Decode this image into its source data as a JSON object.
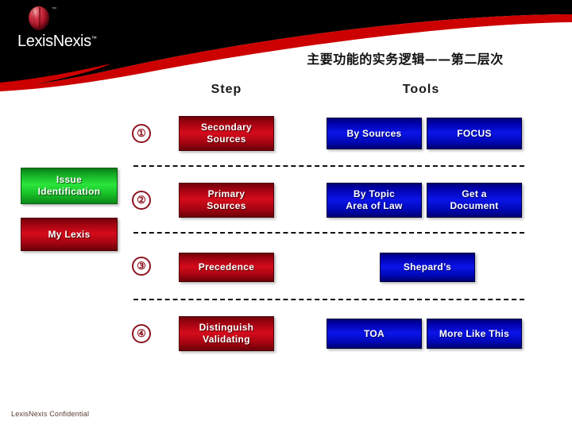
{
  "brand": {
    "logo_name": "lexisnexis-sphere-logo",
    "wordmark": "LexisNexis",
    "trademark": "™",
    "sphere_trademark": "™"
  },
  "title": "主要功能的实务逻辑——第二层次",
  "columns": {
    "step": "Step",
    "tools": "Tools"
  },
  "phases": [
    {
      "label": "Issue\nIdentification",
      "color": "#2ae53b"
    },
    {
      "label": "My Lexis",
      "color": "#d50b1b"
    }
  ],
  "rows": [
    {
      "number": "①",
      "step": "Secondary\nSources",
      "tools": [
        "By Sources",
        "FOCUS"
      ],
      "layout": "two"
    },
    {
      "number": "②",
      "step": "Primary\nSources",
      "tools": [
        "By Topic\nArea of Law",
        "Get a\nDocument"
      ],
      "layout": "two"
    },
    {
      "number": "③",
      "step": "Precedence",
      "tools": [
        "Shepard’s"
      ],
      "layout": "one"
    },
    {
      "number": "④",
      "step": "Distinguish\nValidating",
      "tools": [
        "TOA",
        "More Like This"
      ],
      "layout": "two"
    }
  ],
  "colors": {
    "banner_black": "#000000",
    "banner_red": "#cc0000",
    "step_red": "#d50b1b",
    "tool_blue": "#0b14e8",
    "phase_green": "#2ae53b",
    "number_maroon": "#8c1420",
    "divider": "#111111",
    "footer_text": "#5a3b30"
  },
  "footer": {
    "confidential": "LexisNexis Confidential"
  }
}
